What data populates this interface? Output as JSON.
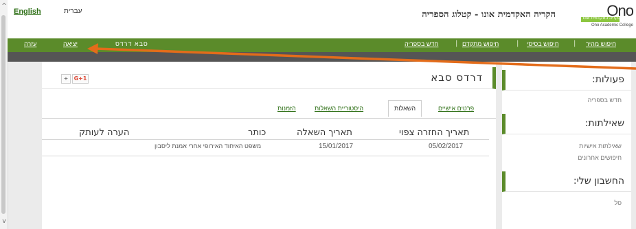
{
  "top": {
    "lang_en": "English",
    "lang_he": "עברית",
    "site_title": "הקריה האקדמית אונו - קטלוג הספריה",
    "logo": {
      "mark": "Ono",
      "hebrew": "הקריה האקדמית אונו",
      "english": "Ono Academic College"
    }
  },
  "nav": {
    "links": [
      "חיפוש מהיר",
      "חיפוש בסיסי",
      "חיפוש מתקדם",
      "חדש בספריה"
    ],
    "user_name": "סבא דרדס",
    "logout": "יציאה",
    "help": "עזרה"
  },
  "sidebar": {
    "actions_title": "פעולות:",
    "actions_items": [
      "חדש בספריה"
    ],
    "loans_title": "שאילתות:",
    "loans_items": [
      "שאילתות אישיות",
      "חיפושים אחרונים"
    ],
    "account_title": "החשבון שלי:",
    "account_items": [
      "סל"
    ]
  },
  "main": {
    "title": "דרדס סבא",
    "share_plus": "+",
    "share_gplus": "G+1",
    "tabs": [
      "פרטים אישיים",
      "השאלות",
      "היסטוריית השאלות",
      "הזמנות"
    ],
    "active_tab": "השאלות",
    "table": {
      "headers": [
        "תאריך החזרה צפוי",
        "תאריך השאלה",
        "כותר",
        "הערה לעותק"
      ],
      "rows": [
        [
          "05/02/2017",
          "15/01/2017",
          "משפט האיחוד האירופי אחרי אמנת ליסבון",
          ""
        ]
      ]
    }
  },
  "colors": {
    "accent_green": "#5b8b2a",
    "link_green": "#2c6e14",
    "annotation_arrow": "#e36c1a"
  }
}
